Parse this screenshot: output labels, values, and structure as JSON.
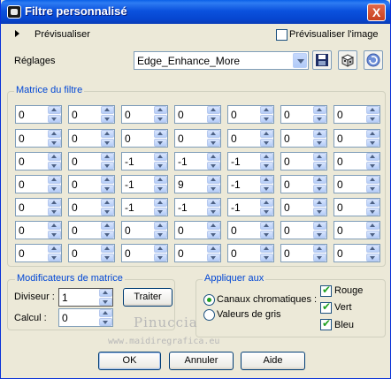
{
  "window": {
    "title": "Filtre personnalisé",
    "close_label": "X"
  },
  "preview": {
    "label": "Prévisualiser",
    "preview_image_label": "Prévisualiser l'image",
    "preview_image_checked": false
  },
  "settings": {
    "label": "Réglages",
    "preset_value": "Edge_Enhance_More"
  },
  "matrix": {
    "label": "Matrice du filtre",
    "rows": [
      [
        "0",
        "0",
        "0",
        "0",
        "0",
        "0",
        "0"
      ],
      [
        "0",
        "0",
        "0",
        "0",
        "0",
        "0",
        "0"
      ],
      [
        "0",
        "0",
        "-1",
        "-1",
        "-1",
        "0",
        "0"
      ],
      [
        "0",
        "0",
        "-1",
        "9",
        "-1",
        "0",
        "0"
      ],
      [
        "0",
        "0",
        "-1",
        "-1",
        "-1",
        "0",
        "0"
      ],
      [
        "0",
        "0",
        "0",
        "0",
        "0",
        "0",
        "0"
      ],
      [
        "0",
        "0",
        "0",
        "0",
        "0",
        "0",
        "0"
      ]
    ]
  },
  "modifiers": {
    "label": "Modificateurs de matrice",
    "divisor_label": "Diviseur :",
    "divisor_value": "1",
    "bias_label": "Calcul :",
    "bias_value": "0",
    "process_button": "Traiter"
  },
  "apply": {
    "label": "Appliquer aux",
    "channels_label": "Canaux chromatiques :",
    "grayscale_label": "Valeurs de gris",
    "selected": "channels",
    "red_label": "Rouge",
    "green_label": "Vert",
    "blue_label": "Bleu",
    "red_checked": true,
    "green_checked": true,
    "blue_checked": true
  },
  "watermark": {
    "line1": "Pinuccia",
    "line2": "www.maidiregrafica.eu"
  },
  "buttons": {
    "ok": "OK",
    "cancel": "Annuler",
    "help": "Aide"
  }
}
